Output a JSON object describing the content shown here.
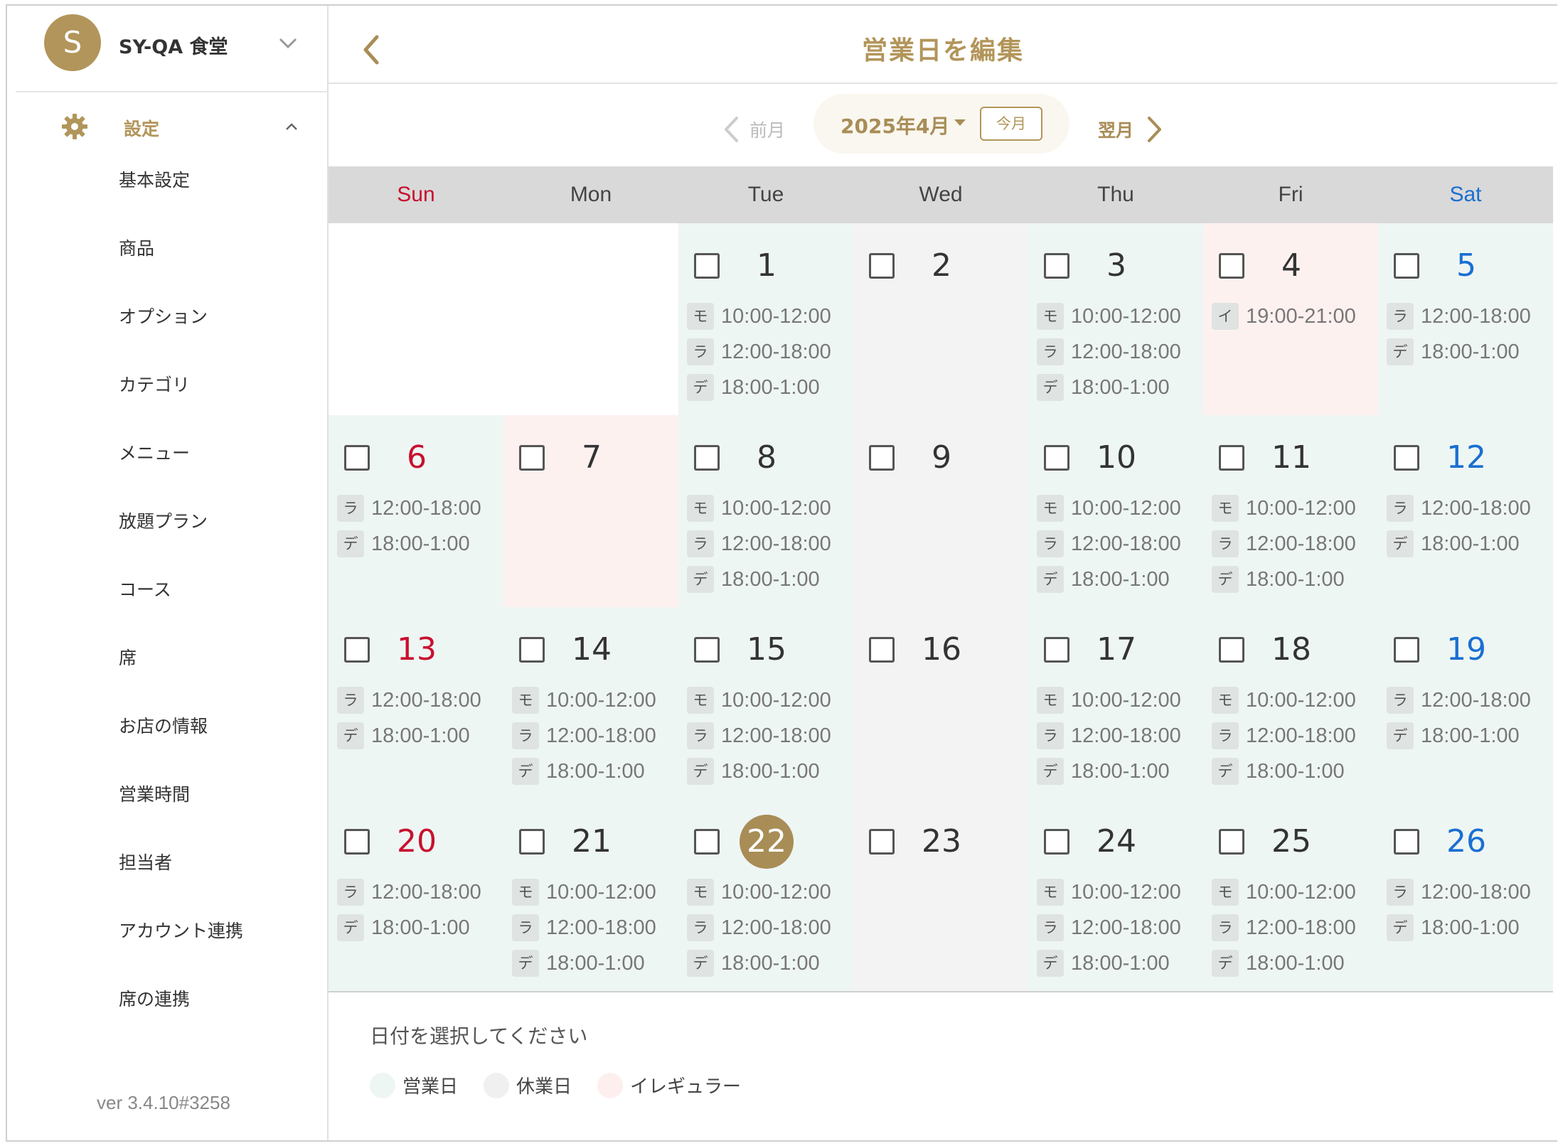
{
  "sidebar": {
    "avatar_letter": "S",
    "store_name": "SY-QA 食堂",
    "settings_label": "設定",
    "items": [
      {
        "label": "基本設定"
      },
      {
        "label": "商品"
      },
      {
        "label": "オプション"
      },
      {
        "label": "カテゴリ"
      },
      {
        "label": "メニュー"
      },
      {
        "label": "放題プラン"
      },
      {
        "label": "コース"
      },
      {
        "label": "席"
      },
      {
        "label": "お店の情報"
      },
      {
        "label": "営業時間"
      },
      {
        "label": "担当者"
      },
      {
        "label": "アカウント連携"
      },
      {
        "label": "席の連携"
      }
    ],
    "version": "ver 3.4.10#3258"
  },
  "header": {
    "title": "営業日を編集"
  },
  "month_nav": {
    "prev_label": "前月",
    "month_label": "2025年4月",
    "today_label": "今月",
    "next_label": "翌月"
  },
  "weekdays": [
    "Sun",
    "Mon",
    "Tue",
    "Wed",
    "Thu",
    "Fri",
    "Sat"
  ],
  "colors": {
    "accent": "#b2955a",
    "open_bg": "#eef6f4",
    "closed_bg": "#f3f3f3",
    "irregular_bg": "#fdf1f0",
    "sunday": "#c8102e",
    "saturday": "#1a6fd1"
  },
  "calendar": {
    "leading_blanks": 2,
    "today": 22,
    "days": [
      {
        "day": "1",
        "status": "open",
        "slots": [
          [
            "モ",
            "10:00-12:00"
          ],
          [
            "ラ",
            "12:00-18:00"
          ],
          [
            "デ",
            "18:00-1:00"
          ]
        ]
      },
      {
        "day": "2",
        "status": "closed",
        "slots": []
      },
      {
        "day": "3",
        "status": "open",
        "slots": [
          [
            "モ",
            "10:00-12:00"
          ],
          [
            "ラ",
            "12:00-18:00"
          ],
          [
            "デ",
            "18:00-1:00"
          ]
        ]
      },
      {
        "day": "4",
        "status": "irregular",
        "slots": [
          [
            "イ",
            "19:00-21:00"
          ]
        ]
      },
      {
        "day": "5",
        "status": "open",
        "slots": [
          [
            "ラ",
            "12:00-18:00"
          ],
          [
            "デ",
            "18:00-1:00"
          ]
        ]
      },
      {
        "day": "6",
        "status": "open",
        "slots": [
          [
            "ラ",
            "12:00-18:00"
          ],
          [
            "デ",
            "18:00-1:00"
          ]
        ]
      },
      {
        "day": "7",
        "status": "irregular",
        "slots": []
      },
      {
        "day": "8",
        "status": "open",
        "slots": [
          [
            "モ",
            "10:00-12:00"
          ],
          [
            "ラ",
            "12:00-18:00"
          ],
          [
            "デ",
            "18:00-1:00"
          ]
        ]
      },
      {
        "day": "9",
        "status": "closed",
        "slots": []
      },
      {
        "day": "10",
        "status": "open",
        "slots": [
          [
            "モ",
            "10:00-12:00"
          ],
          [
            "ラ",
            "12:00-18:00"
          ],
          [
            "デ",
            "18:00-1:00"
          ]
        ]
      },
      {
        "day": "11",
        "status": "open",
        "slots": [
          [
            "モ",
            "10:00-12:00"
          ],
          [
            "ラ",
            "12:00-18:00"
          ],
          [
            "デ",
            "18:00-1:00"
          ]
        ]
      },
      {
        "day": "12",
        "status": "open",
        "slots": [
          [
            "ラ",
            "12:00-18:00"
          ],
          [
            "デ",
            "18:00-1:00"
          ]
        ]
      },
      {
        "day": "13",
        "status": "open",
        "slots": [
          [
            "ラ",
            "12:00-18:00"
          ],
          [
            "デ",
            "18:00-1:00"
          ]
        ]
      },
      {
        "day": "14",
        "status": "open",
        "slots": [
          [
            "モ",
            "10:00-12:00"
          ],
          [
            "ラ",
            "12:00-18:00"
          ],
          [
            "デ",
            "18:00-1:00"
          ]
        ]
      },
      {
        "day": "15",
        "status": "open",
        "slots": [
          [
            "モ",
            "10:00-12:00"
          ],
          [
            "ラ",
            "12:00-18:00"
          ],
          [
            "デ",
            "18:00-1:00"
          ]
        ]
      },
      {
        "day": "16",
        "status": "closed",
        "slots": []
      },
      {
        "day": "17",
        "status": "open",
        "slots": [
          [
            "モ",
            "10:00-12:00"
          ],
          [
            "ラ",
            "12:00-18:00"
          ],
          [
            "デ",
            "18:00-1:00"
          ]
        ]
      },
      {
        "day": "18",
        "status": "open",
        "slots": [
          [
            "モ",
            "10:00-12:00"
          ],
          [
            "ラ",
            "12:00-18:00"
          ],
          [
            "デ",
            "18:00-1:00"
          ]
        ]
      },
      {
        "day": "19",
        "status": "open",
        "slots": [
          [
            "ラ",
            "12:00-18:00"
          ],
          [
            "デ",
            "18:00-1:00"
          ]
        ]
      },
      {
        "day": "20",
        "status": "open",
        "slots": [
          [
            "ラ",
            "12:00-18:00"
          ],
          [
            "デ",
            "18:00-1:00"
          ]
        ]
      },
      {
        "day": "21",
        "status": "open",
        "slots": [
          [
            "モ",
            "10:00-12:00"
          ],
          [
            "ラ",
            "12:00-18:00"
          ],
          [
            "デ",
            "18:00-1:00"
          ]
        ]
      },
      {
        "day": "22",
        "status": "open",
        "slots": [
          [
            "モ",
            "10:00-12:00"
          ],
          [
            "ラ",
            "12:00-18:00"
          ],
          [
            "デ",
            "18:00-1:00"
          ]
        ]
      },
      {
        "day": "23",
        "status": "closed",
        "slots": []
      },
      {
        "day": "24",
        "status": "open",
        "slots": [
          [
            "モ",
            "10:00-12:00"
          ],
          [
            "ラ",
            "12:00-18:00"
          ],
          [
            "デ",
            "18:00-1:00"
          ]
        ]
      },
      {
        "day": "25",
        "status": "open",
        "slots": [
          [
            "モ",
            "10:00-12:00"
          ],
          [
            "ラ",
            "12:00-18:00"
          ],
          [
            "デ",
            "18:00-1:00"
          ]
        ]
      },
      {
        "day": "26",
        "status": "open",
        "slots": [
          [
            "ラ",
            "12:00-18:00"
          ],
          [
            "デ",
            "18:00-1:00"
          ]
        ]
      }
    ]
  },
  "footer": {
    "hint": "日付を選択してください",
    "legend": [
      {
        "label": "営業日",
        "color": "#eef6f4"
      },
      {
        "label": "休業日",
        "color": "#f0f0f0"
      },
      {
        "label": "イレギュラー",
        "color": "#fdefee"
      }
    ]
  }
}
